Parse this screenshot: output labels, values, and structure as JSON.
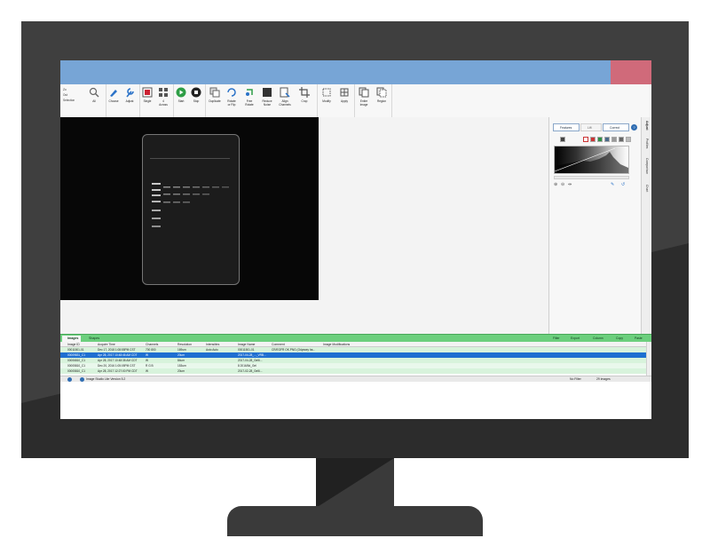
{
  "colors": {
    "title_bar": "#77a5d6",
    "close_block": "#d06a7a",
    "bottom_bar": "#6ccf7d",
    "selected_row": "#1f6fd1"
  },
  "ribbon": {
    "zoom_items": [
      "Zo",
      "Out",
      "Selection"
    ],
    "all_label": "All",
    "groups": [
      {
        "label": "Zoom"
      },
      {
        "label": "Display"
      },
      {
        "label": "View Mode"
      },
      {
        "label": "Slide Show"
      },
      {
        "label": "Create"
      },
      {
        "label": "Print/Export Area"
      },
      {
        "label": "Copy"
      }
    ],
    "buttons": {
      "choose": "Choose",
      "adjust": "Adjust",
      "single": "Single",
      "across": "4\nAcross",
      "start": "Start",
      "stop": "Stop",
      "duplicate": "Duplicate",
      "rotate_flip": "Rotate\nor Flip",
      "free_rotate": "Free\nRotate",
      "reduce_noise": "Reduce\nNoise",
      "align_channels": "Align\nChannels",
      "crop": "Crop",
      "modify": "Modify",
      "apply": "Apply",
      "entire_image": "Entire\nImage",
      "region": "Region"
    }
  },
  "right_panel": {
    "tabs": [
      "Features",
      "Lift",
      "Correct"
    ],
    "side_tabs": [
      "Adjust",
      "Profiles",
      "Comparison",
      "Chart"
    ]
  },
  "bottom_bar": {
    "tabs": [
      "Images",
      "Shapes"
    ],
    "actions": [
      "Filter",
      "Export",
      "Column",
      "Copy",
      "Paste"
    ]
  },
  "table": {
    "headers": [
      "Image ID",
      "Acquire Time",
      "Channels",
      "Resolution",
      "Intensities",
      "Image Name",
      "Comment",
      "Image Modifications"
    ],
    "rows": [
      [
        "00011501-01",
        "Dec 17, 2018 1:08:55PM CST",
        "700 800",
        "169um",
        "Auto Auto",
        "00011501-01",
        "CR/EGFR OK.PNG (Odyssey ha...",
        ""
      ],
      [
        "00009831_C1",
        "Apr 28, 2017 10:48:46 AM CDT",
        "W",
        "20um",
        "",
        "2017-04-28_..._VRB...",
        "",
        ""
      ],
      [
        "00006810_C1",
        "Apr 28, 2017 10:48:38 AM CDT",
        "W",
        "84um",
        "",
        "2017-04-28_Gel6...",
        "",
        ""
      ],
      [
        "00005810_C1",
        "Dec 20, 2016 1:05:05PM CST",
        "R G B",
        "153um",
        "",
        "8 2016/5d_Gel",
        "",
        ""
      ],
      [
        "00005810_C1",
        "Apr 28, 2017 12:27:00 PM CDT",
        "W",
        "20um",
        "",
        "2017-02-28_Gel6...",
        "",
        ""
      ]
    ]
  },
  "status": {
    "version": "Image Studio Lite Version 5.2",
    "filter": "No Filter",
    "count": "29 images"
  }
}
